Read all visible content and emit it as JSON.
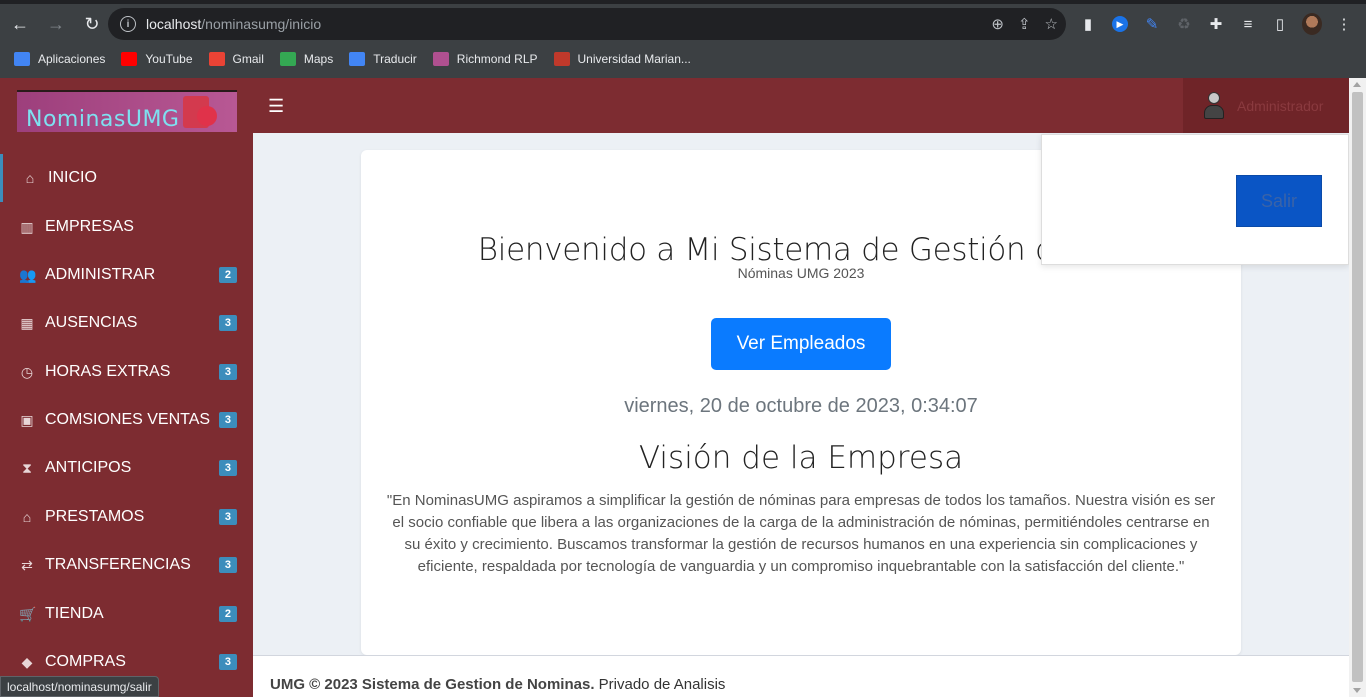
{
  "browser": {
    "url_host": "localhost",
    "url_path": "/nominasumg/inicio",
    "bookmarks": [
      {
        "label": "Aplicaciones",
        "color": "#4285f4"
      },
      {
        "label": "YouTube",
        "color": "#ff0000"
      },
      {
        "label": "Gmail",
        "color": "#ea4335"
      },
      {
        "label": "Maps",
        "color": "#34a853"
      },
      {
        "label": "Traducir",
        "color": "#4285f4"
      },
      {
        "label": "Richmond RLP",
        "color": "#b05090"
      },
      {
        "label": "Universidad Marian...",
        "color": "#c0392b"
      }
    ],
    "status_url": "localhost/nominasumg/salir"
  },
  "app": {
    "logo_text": "NominasUMG",
    "user_name": "Administrador",
    "salir_label": "Salir"
  },
  "sidebar": {
    "items": [
      {
        "label": "INICIO",
        "icon": "home-icon",
        "glyph": "⌂",
        "badge": ""
      },
      {
        "label": "EMPRESAS",
        "icon": "building-icon",
        "glyph": "▥",
        "badge": ""
      },
      {
        "label": "ADMINISTRAR",
        "icon": "users-icon",
        "glyph": "👥",
        "badge": "2"
      },
      {
        "label": "AUSENCIAS",
        "icon": "calendar-icon",
        "glyph": "▦",
        "badge": "3"
      },
      {
        "label": "HORAS EXTRAS",
        "icon": "clock-icon",
        "glyph": "◷",
        "badge": "3"
      },
      {
        "label": "COMSIONES VENTAS",
        "icon": "money-icon",
        "glyph": "▣",
        "badge": "3"
      },
      {
        "label": "ANTICIPOS",
        "icon": "hourglass-icon",
        "glyph": "⧗",
        "badge": "3"
      },
      {
        "label": "PRESTAMOS",
        "icon": "bank-icon",
        "glyph": "⌂",
        "badge": "3"
      },
      {
        "label": "TRANSFERENCIAS",
        "icon": "exchange-icon",
        "glyph": "⇄",
        "badge": "3"
      },
      {
        "label": "TIENDA",
        "icon": "cart-icon",
        "glyph": "🛒",
        "badge": "2"
      },
      {
        "label": "COMPRAS",
        "icon": "tags-icon",
        "glyph": "◆",
        "badge": "3"
      }
    ]
  },
  "main": {
    "welcome": "Bienvenido a Mi Sistema de Gestión de Nó",
    "subtitle": "Nóminas UMG 2023",
    "ver_button": "Ver Empleados",
    "datetime": "viernes, 20 de octubre de 2023, 0:34:07",
    "vision_title": "Visión de la Empresa",
    "vision_text": "\"En NominasUMG aspiramos a simplificar la gestión de nóminas para empresas de todos los tamaños. Nuestra visión es ser el socio confiable que libera a las organizaciones de la carga de la administración de nóminas, permitiéndoles centrarse en su éxito y crecimiento. Buscamos transformar la gestión de recursos humanos en una experiencia sin complicaciones y eficiente, respaldada por tecnología de vanguardia y un compromiso inquebrantable con la satisfacción del cliente.\""
  },
  "footer": {
    "bold": "UMG © 2023 Sistema de Gestion de Nominas.",
    "normal": " Privado de Analisis"
  }
}
